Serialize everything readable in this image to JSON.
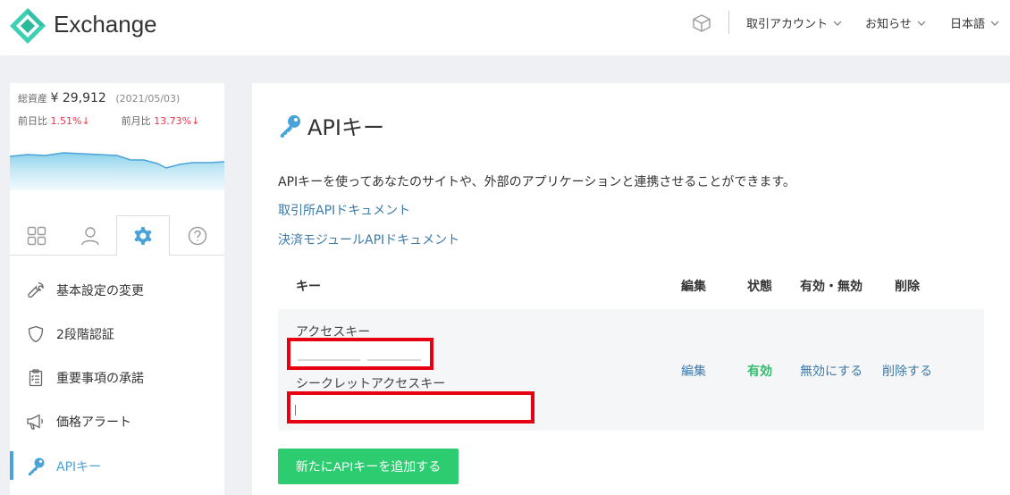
{
  "header": {
    "brand": "Exchange",
    "menu": [
      {
        "label": "取引アカウント"
      },
      {
        "label": "お知らせ"
      },
      {
        "label": "日本語"
      }
    ]
  },
  "sidebar": {
    "assets": {
      "total_label": "総資産",
      "total_value": "¥ 29,912",
      "date": "(2021/05/03)",
      "day_label": "前日比",
      "day_value": "1.51%↓",
      "month_label": "前月比",
      "month_value": "13.73%↓"
    },
    "tabs": [
      {
        "icon": "grid-icon"
      },
      {
        "icon": "user-icon"
      },
      {
        "icon": "gear-icon",
        "active": true
      },
      {
        "icon": "help-icon"
      }
    ],
    "nav": [
      {
        "label": "基本設定の変更",
        "icon": "wrench-icon"
      },
      {
        "label": "2段階認証",
        "icon": "shield-icon"
      },
      {
        "label": "重要事項の承諾",
        "icon": "clipboard-icon"
      },
      {
        "label": "価格アラート",
        "icon": "megaphone-icon"
      },
      {
        "label": "APIキー",
        "icon": "key-icon",
        "active": true
      }
    ]
  },
  "main": {
    "title": "APIキー",
    "description": "APIキーを使ってあなたのサイトや、外部のアプリケーションと連携させることができます。",
    "links": [
      {
        "label": "取引所APIドキュメント"
      },
      {
        "label": "決済モジュールAPIドキュメント"
      }
    ],
    "table": {
      "headers": {
        "key": "キー",
        "edit": "編集",
        "status": "状態",
        "toggle": "有効・無効",
        "delete": "削除"
      },
      "row": {
        "access_key_label": "アクセスキー",
        "secret_key_label": "シークレットアクセスキー",
        "edit": "編集",
        "status": "有効",
        "toggle": "無効にする",
        "delete": "削除する"
      }
    },
    "add_button": "新たにAPIキーを追加する"
  },
  "colors": {
    "accent": "#4aa3d8",
    "brand_teal": "#3ecfb4",
    "link": "#3d7aa8",
    "ok": "#2dbf6c",
    "button": "#2ecc71",
    "negative": "#e8384f",
    "highlight_box": "#e60012"
  }
}
